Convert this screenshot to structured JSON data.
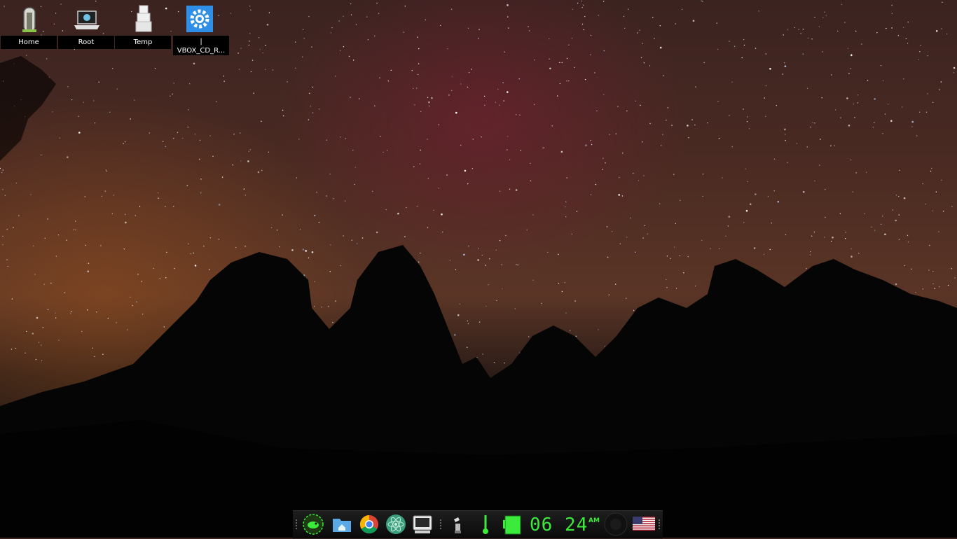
{
  "desktop": {
    "icons": [
      {
        "label": "Home",
        "icon": "home-door-icon"
      },
      {
        "label": "Root",
        "icon": "laptop-drive-icon"
      },
      {
        "label": "Temp",
        "icon": "stacked-boxes-icon"
      },
      {
        "label": "|\nVBOX_CD_R...",
        "icon": "gear-settings-icon"
      }
    ]
  },
  "taskbar": {
    "launchers": [
      {
        "name": "menu",
        "icon": "opensuse-chameleon-icon"
      },
      {
        "name": "files",
        "icon": "home-folder-icon"
      },
      {
        "name": "browser",
        "icon": "chrome-icon"
      },
      {
        "name": "editor",
        "icon": "atom-icon"
      },
      {
        "name": "terminal",
        "icon": "monitor-terminal-icon"
      }
    ],
    "tray": {
      "usb_icon": "usb-plug-icon",
      "temperature_icon": "thermometer-icon",
      "battery_icon": "battery-icon",
      "clock_time": "06 24",
      "clock_ampm": "AM",
      "volume_icon": "speaker-knob-icon",
      "keyboard_layout_icon": "us-flag-icon"
    },
    "accent_color": "#3bea3b"
  }
}
